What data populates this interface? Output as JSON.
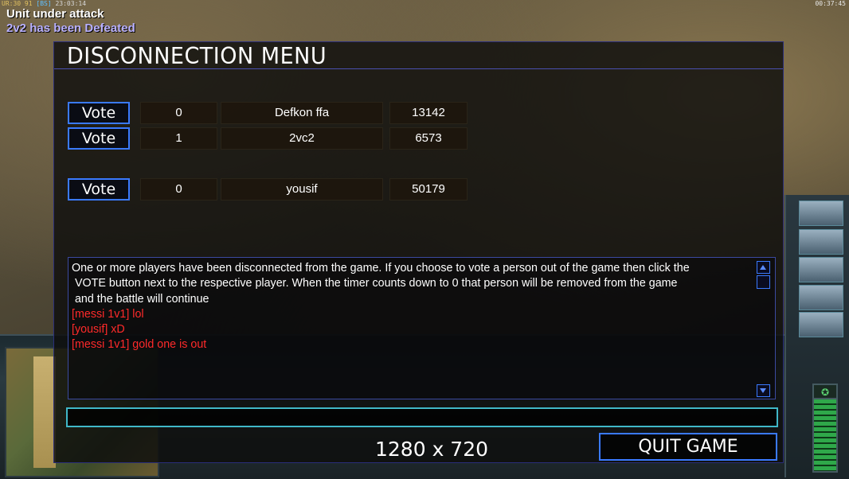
{
  "hud": {
    "top_left_ur": "UR:30",
    "top_left_num": "91",
    "top_left_bs": "[BS]",
    "top_left_time": "23:03:14",
    "top_right_time": "00:37:45",
    "messages": [
      "Unit under attack",
      "2v2 has been Defeated"
    ],
    "message_colors": [
      "#ffffff",
      "#b8b0ff"
    ]
  },
  "dialog": {
    "title": "DISCONNECTION MENU",
    "vote_label": "Vote",
    "players": [
      {
        "slot": "0",
        "name": "Defkon ffa",
        "ping": "13142"
      },
      {
        "slot": "1",
        "name": "2vc2",
        "ping": "6573"
      },
      {
        "slot": "0",
        "name": "yousif",
        "ping": "50179"
      }
    ],
    "chat": [
      {
        "text": "One or more players have been disconnected from the game. If you choose to vote a person out of the game then click the",
        "color": "white"
      },
      {
        "text": " VOTE button next to the respective player. When the timer counts down to 0 that person will be removed from the game",
        "color": "white"
      },
      {
        "text": " and the battle will continue",
        "color": "white"
      },
      {
        "text": "[messi 1v1] lol",
        "color": "red"
      },
      {
        "text": "[yousif] xD",
        "color": "red"
      },
      {
        "text": "[messi 1v1] gold one is out",
        "color": "red"
      }
    ],
    "chat_input_value": "",
    "resolution": "1280 x 720",
    "quit_label": "QUIT GAME"
  },
  "colors": {
    "accent_blue": "#3a7aff",
    "chat_red": "#ff2a2a",
    "input_border": "#40b8c8"
  }
}
